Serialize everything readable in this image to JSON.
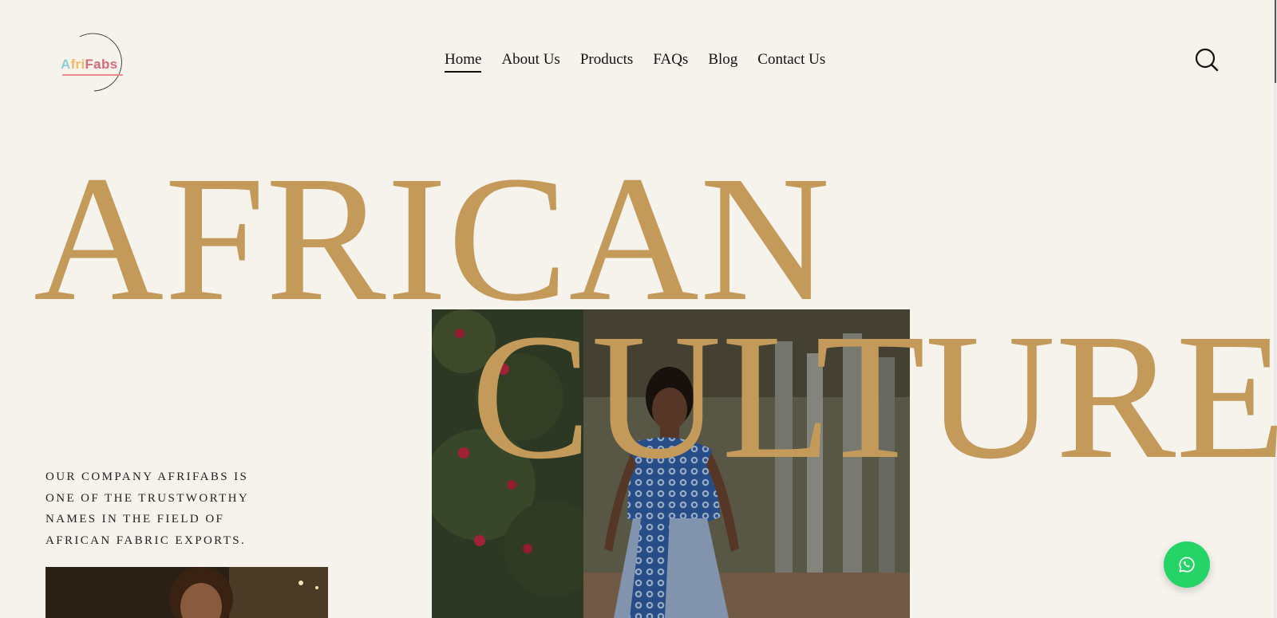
{
  "logo": {
    "parts": [
      "A",
      "fri",
      "Fa",
      "bs"
    ],
    "tagline": ""
  },
  "nav": {
    "items": [
      {
        "label": "Home",
        "active": true
      },
      {
        "label": "About Us",
        "active": false
      },
      {
        "label": "Products",
        "active": false
      },
      {
        "label": "FAQs",
        "active": false
      },
      {
        "label": "Blog",
        "active": false
      },
      {
        "label": "Contact Us",
        "active": false
      }
    ]
  },
  "search": {
    "icon": "search-icon"
  },
  "hero": {
    "line1": "AFRICAN",
    "line2": "CULTURE",
    "color": "#c49a5a"
  },
  "intro": {
    "text": "OUR COMPANY AFRIFABS IS ONE OF THE TRUSTWORTHY NAMES IN THE FIELD OF AFRICAN FABRIC EXPORTS."
  },
  "whatsapp": {
    "icon": "whatsapp-icon",
    "color": "#25d366"
  },
  "colors": {
    "background": "#f5f3ec",
    "accent": "#c49a5a"
  }
}
